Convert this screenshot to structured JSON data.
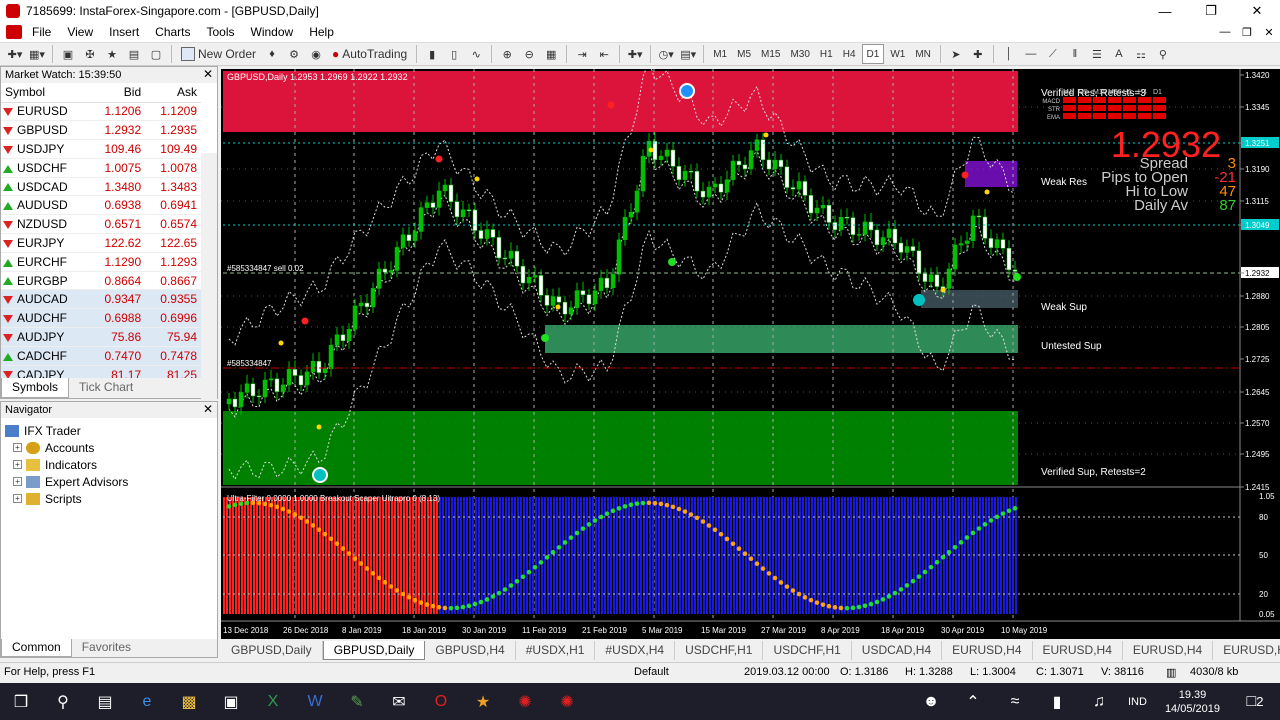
{
  "window": {
    "title": "7185699: InstaForex-Singapore.com - [GBPUSD,Daily]"
  },
  "menu": [
    "File",
    "View",
    "Insert",
    "Charts",
    "Tools",
    "Window",
    "Help"
  ],
  "toolbar": {
    "new_order": "New Order",
    "autotrading": "AutoTrading",
    "timeframes": [
      "M1",
      "M5",
      "M15",
      "M30",
      "H1",
      "H4",
      "D1",
      "W1",
      "MN"
    ]
  },
  "market_watch": {
    "title": "Market Watch: 15:39:50",
    "headers": {
      "symbol": "Symbol",
      "bid": "Bid",
      "ask": "Ask"
    },
    "rows": [
      {
        "symbol": "EURUSD",
        "bid": "1.1206",
        "ask": "1.1209",
        "dir": "down"
      },
      {
        "symbol": "GBPUSD",
        "bid": "1.2932",
        "ask": "1.2935",
        "dir": "down"
      },
      {
        "symbol": "USDJPY",
        "bid": "109.46",
        "ask": "109.49",
        "dir": "down"
      },
      {
        "symbol": "USDCHF",
        "bid": "1.0075",
        "ask": "1.0078",
        "dir": "up"
      },
      {
        "symbol": "USDCAD",
        "bid": "1.3480",
        "ask": "1.3483",
        "dir": "up"
      },
      {
        "symbol": "AUDUSD",
        "bid": "0.6938",
        "ask": "0.6941",
        "dir": "up"
      },
      {
        "symbol": "NZDUSD",
        "bid": "0.6571",
        "ask": "0.6574",
        "dir": "down"
      },
      {
        "symbol": "EURJPY",
        "bid": "122.62",
        "ask": "122.65",
        "dir": "down"
      },
      {
        "symbol": "EURCHF",
        "bid": "1.1290",
        "ask": "1.1293",
        "dir": "up"
      },
      {
        "symbol": "EURGBP",
        "bid": "0.8664",
        "ask": "0.8667",
        "dir": "up"
      },
      {
        "symbol": "AUDCAD",
        "bid": "0.9347",
        "ask": "0.9355",
        "dir": "down"
      },
      {
        "symbol": "AUDCHF",
        "bid": "0.6988",
        "ask": "0.6996",
        "dir": "down"
      },
      {
        "symbol": "AUDJPY",
        "bid": "75.86",
        "ask": "75.94",
        "dir": "down"
      },
      {
        "symbol": "CADCHF",
        "bid": "0.7470",
        "ask": "0.7478",
        "dir": "up"
      },
      {
        "symbol": "CADJPY",
        "bid": "81.17",
        "ask": "81.25",
        "dir": "down"
      }
    ],
    "tabs": [
      "Symbols",
      "Tick Chart"
    ]
  },
  "navigator": {
    "title": "Navigator",
    "items": [
      "IFX Trader",
      "Accounts",
      "Indicators",
      "Expert Advisors",
      "Scripts"
    ],
    "tabs": [
      "Common",
      "Favorites"
    ]
  },
  "chart": {
    "header": "GBPUSD,Daily  1.2953 1.2969 1.2922 1.2932",
    "price_axis": [
      "1.3420",
      "1.3345",
      "1.3251",
      "1.3190",
      "1.3115",
      "1.3049",
      "1.2932",
      "1.2880",
      "1.2805",
      "1.2725",
      "1.2645",
      "1.2570",
      "1.2495",
      "1.2415"
    ],
    "highlight_prices": [
      "1.3251",
      "1.3049",
      "1.2932"
    ],
    "date_axis": [
      "13 Dec 2018",
      "26 Dec 2018",
      "8 Jan 2019",
      "18 Jan 2019",
      "30 Jan 2019",
      "11 Feb 2019",
      "21 Feb 2019",
      "5 Mar 2019",
      "15 Mar 2019",
      "27 Mar 2019",
      "8 Apr 2019",
      "18 Apr 2019",
      "30 Apr 2019",
      "10 May 2019"
    ],
    "order_labels": [
      "#585334847 sell 0.02",
      "#585334847"
    ],
    "zones": [
      "Verified Res, Retests=3",
      "Weak Res",
      "Weak Sup",
      "Untested Sup",
      "Verified Sup, Retests=2"
    ],
    "dashboard": {
      "tfs": [
        "M1",
        "M5",
        "M15",
        "M30",
        "H1",
        "H4",
        "D1"
      ],
      "rows": [
        "MACD",
        "STR",
        "EMA"
      ],
      "price": "1.2932",
      "lines": [
        {
          "label": "Spread",
          "value": "3"
        },
        {
          "label": "Pips to Open",
          "value": "-21"
        },
        {
          "label": "Hi to Low",
          "value": "47"
        },
        {
          "label": "Daily Av",
          "value": "87"
        }
      ]
    },
    "indicator": {
      "header": "Ultra-Filter 0.0000 1.0000  Breakout Scaper Uitrapro 0 (8.13)",
      "axis": [
        "1.05",
        "80",
        "50",
        "20",
        "0.05"
      ]
    }
  },
  "chart_tabs": [
    "GBPUSD,Daily",
    "GBPUSD,Daily",
    "GBPUSD,H4",
    "#USDX,H1",
    "#USDX,H4",
    "USDCHF,H1",
    "USDCHF,H1",
    "USDCAD,H4",
    "EURUSD,H4",
    "EURUSD,H4",
    "EURUSD,H4",
    "EURUSD,H4"
  ],
  "status": {
    "help": "For Help, press F1",
    "profile": "Default",
    "datetime": "2019.03.12 00:00",
    "open": "O: 1.3186",
    "high": "H: 1.3288",
    "low": "L: 1.3004",
    "close": "C: 1.3071",
    "volume": "V: 38116",
    "traffic": "4030/8 kb"
  },
  "taskbar": {
    "lang": "IND",
    "time": "19.39",
    "date": "14/05/2019",
    "notif": "2"
  },
  "colors": {
    "bull": "#00c000",
    "bear": "#ffffff",
    "res_zone": "#dc143c",
    "sup_zone": "#008000",
    "untested": "#2e8b57",
    "hist_red": "#ff2020",
    "hist_blue": "#1a1ad8"
  }
}
